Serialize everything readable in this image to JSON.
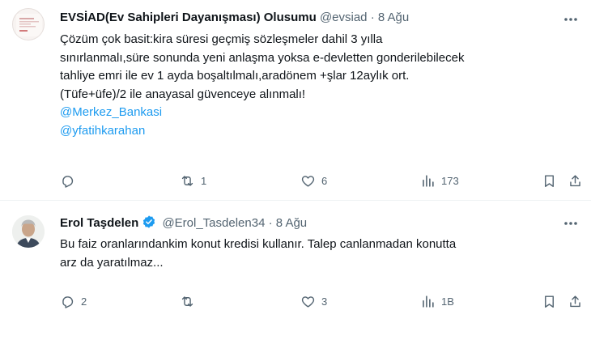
{
  "tweet1": {
    "display_name": "EVSİAD(Ev Sahipleri Dayanışması) Olusumu",
    "handle": "@evsiad",
    "separator": "·",
    "date": "8 Ağu",
    "body_lines": [
      "Çözüm çok basit:kira süresi geçmiş sözleşmeler dahil 3 yılla",
      "sınırlanmalı,süre sonunda yeni anlaşma yoksa e-devletten gonderilebilecek",
      "tahliye emri ile ev 1 ayda boşaltılmalı,aradönem +şlar 12aylık ort.",
      "(Tüfe+üfe)/2 ile anayasal güvenceye alınmalı!"
    ],
    "mentions": [
      "@Merkez_Bankasi",
      "@yfatihkarahan"
    ],
    "actions": {
      "reply": {
        "icon": "reply-icon",
        "count": ""
      },
      "retweet": {
        "icon": "retweet-icon",
        "count": "1"
      },
      "like": {
        "icon": "heart-icon",
        "count": "6"
      },
      "views": {
        "icon": "views-icon",
        "count": "173"
      },
      "bookmark": {
        "icon": "bookmark-icon"
      },
      "share": {
        "icon": "share-icon"
      }
    }
  },
  "tweet2": {
    "display_name": "Erol Taşdelen",
    "verified": true,
    "handle": "@Erol_Tasdelen34",
    "separator": "·",
    "date": "8 Ağu",
    "body_lines": [
      "Bu faiz oranlarındankim konut kredisi kullanır. Talep canlanmadan konutta",
      "arz da yaratılmaz..."
    ],
    "actions": {
      "reply": {
        "icon": "reply-icon",
        "count": "2"
      },
      "retweet": {
        "icon": "retweet-icon",
        "count": ""
      },
      "like": {
        "icon": "heart-icon",
        "count": "3"
      },
      "views": {
        "icon": "views-icon",
        "count": "1B"
      },
      "bookmark": {
        "icon": "bookmark-icon"
      },
      "share": {
        "icon": "share-icon"
      }
    }
  },
  "colors": {
    "text": "#0f1419",
    "muted": "#536471",
    "link": "#1d9bf0",
    "verified": "#1d9bf0",
    "divider": "#eff3f4"
  }
}
